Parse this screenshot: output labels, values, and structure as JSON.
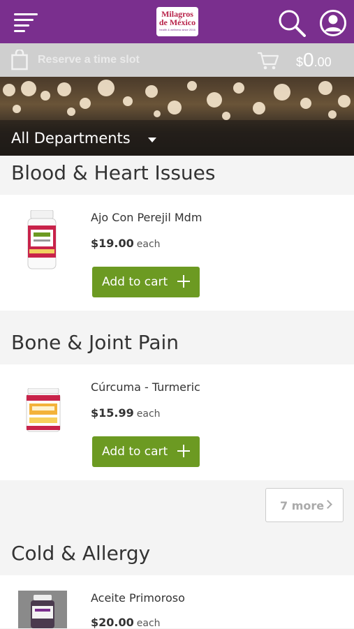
{
  "header": {
    "logo_line1": "Milagros",
    "logo_line2": "de México",
    "logo_tagline": "health & wellness since 2016"
  },
  "subbar": {
    "reserve_label": "Reserve a time slot",
    "cart_currency": "$",
    "cart_dollars": "0",
    "cart_cents": ".00"
  },
  "departments": {
    "selected": "All Departments"
  },
  "categories": [
    {
      "title": "Blood & Heart Issues",
      "products": [
        {
          "name": "Ajo Con Perejil Mdm",
          "price": "$19.00",
          "unit": "each",
          "button": "Add to cart"
        }
      ]
    },
    {
      "title": "Bone & Joint Pain",
      "products": [
        {
          "name": "Cúrcuma - Turmeric",
          "price": "$15.99",
          "unit": "each",
          "button": "Add to cart"
        }
      ],
      "more_label": "7 more"
    },
    {
      "title": "Cold & Allergy",
      "products": [
        {
          "name": "Aceite Primoroso",
          "price": "$20.00",
          "unit": "each"
        }
      ]
    }
  ],
  "colors": {
    "brand_purple": "#7a2f8e",
    "add_button_green": "#6c9a22"
  }
}
